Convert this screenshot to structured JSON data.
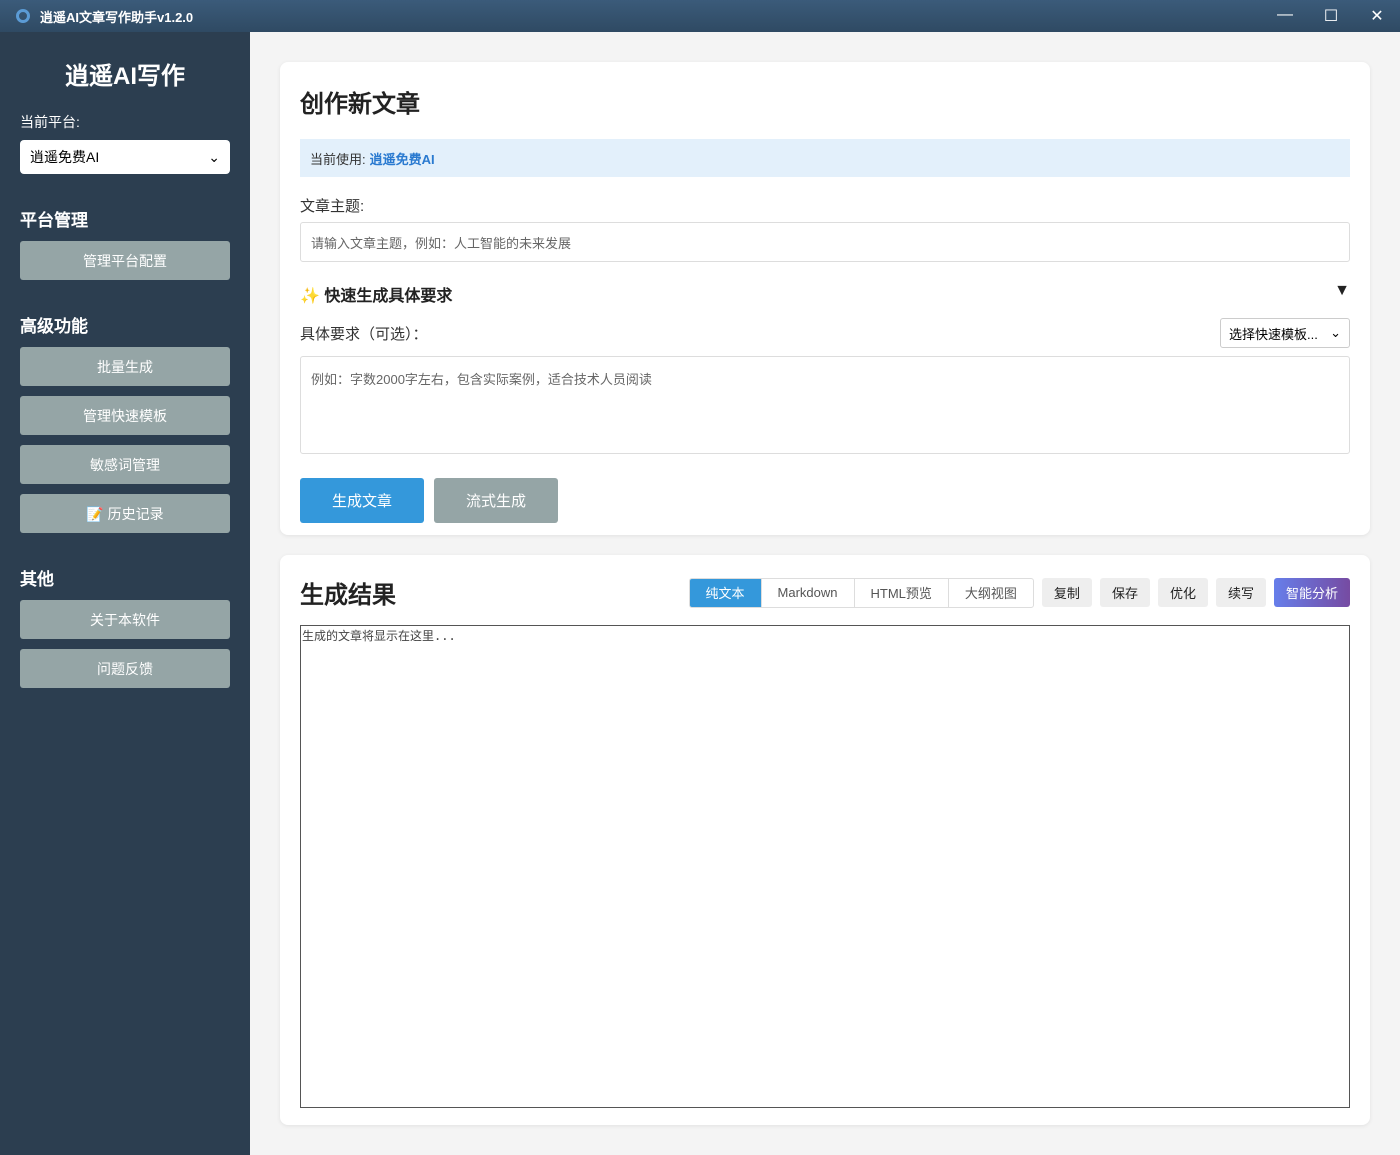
{
  "window": {
    "title": "逍遥AI文章写作助手v1.2.0",
    "minimize": "—",
    "maximize": "☐",
    "close": "✕"
  },
  "sidebar": {
    "brand": "逍遥AI写作",
    "platform_label": "当前平台:",
    "platform_value": "逍遥免费AI",
    "sections": [
      {
        "title": "平台管理",
        "items": [
          "管理平台配置"
        ]
      },
      {
        "title": "高级功能",
        "items": [
          "批量生成",
          "管理快速模板",
          "敏感词管理",
          "📝 历史记录"
        ]
      },
      {
        "title": "其他",
        "items": [
          "关于本软件",
          "问题反馈"
        ]
      }
    ]
  },
  "create": {
    "title": "创作新文章",
    "current_label": "当前使用:",
    "current_value": "逍遥免费AI",
    "topic_label": "文章主题:",
    "topic_placeholder": "请输入文章主题，例如：人工智能的未来发展",
    "quick_title": "✨ 快速生成具体要求",
    "quick_toggle": "▼",
    "req_label": "具体要求（可选）：",
    "template_select": "选择快速模板...",
    "req_placeholder": "例如：字数2000字左右，包含实际案例，适合技术人员阅读",
    "generate": "生成文章",
    "stream": "流式生成"
  },
  "result": {
    "title": "生成结果",
    "tabs": [
      "纯文本",
      "Markdown",
      "HTML预览",
      "大纲视图"
    ],
    "actions": [
      "复制",
      "保存",
      "优化",
      "续写",
      "智能分析"
    ],
    "placeholder": "生成的文章将显示在这里..."
  }
}
